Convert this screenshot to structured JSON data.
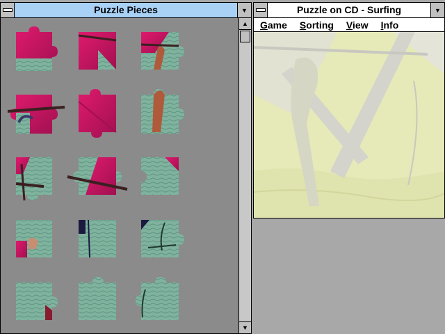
{
  "pieces_window": {
    "title": "Puzzle Pieces",
    "scroll_up": "▲",
    "scroll_down": "▼",
    "pieces": [
      {
        "id": "r1c1",
        "style": "pink-water"
      },
      {
        "id": "r1c2",
        "style": "pink"
      },
      {
        "id": "r1c3",
        "style": "arm-water"
      },
      {
        "id": "r2c1",
        "style": "pink-boom"
      },
      {
        "id": "r2c2",
        "style": "pink"
      },
      {
        "id": "r2c3",
        "style": "arm-water"
      },
      {
        "id": "r3c1",
        "style": "mast-water"
      },
      {
        "id": "r3c2",
        "style": "boom-pink"
      },
      {
        "id": "r3c3",
        "style": "water-pink"
      },
      {
        "id": "r4c1",
        "style": "water-pink"
      },
      {
        "id": "r4c2",
        "style": "water-line"
      },
      {
        "id": "r4c3",
        "style": "water-rope"
      },
      {
        "id": "r5c1",
        "style": "water"
      },
      {
        "id": "r5c2",
        "style": "water"
      },
      {
        "id": "r5c3",
        "style": "water-line"
      }
    ]
  },
  "puzzle_window": {
    "title": "Puzzle on CD - Surfing",
    "menu": [
      {
        "label": "Game",
        "ul": "G",
        "rest": "ame"
      },
      {
        "label": "Sorting",
        "ul": "S",
        "rest": "orting"
      },
      {
        "label": "View",
        "ul": "V",
        "rest": "iew"
      },
      {
        "label": "Info",
        "ul": "I",
        "rest": "nfo"
      }
    ]
  },
  "colors": {
    "titlebar_active": "#a9d1f6",
    "pieces_bg": "#8b8b8b",
    "desktop": "#a8a8a8",
    "sail": "#c2185b",
    "water": "#7fb39e",
    "puzzle_bg": "#e6e9b8"
  }
}
